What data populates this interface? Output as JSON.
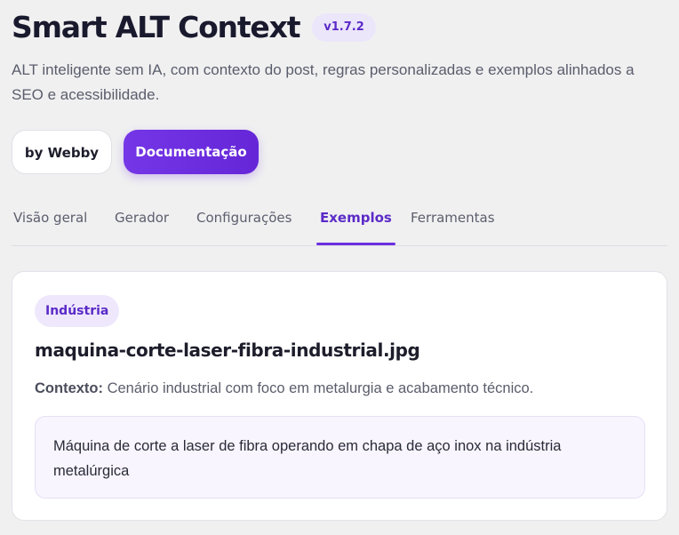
{
  "header": {
    "title": "Smart ALT Context",
    "version": "v1.7.2",
    "subtitle": "ALT inteligente sem IA, com contexto do post, regras personalizadas e exemplos alinhados a SEO e acessibilidade."
  },
  "buttons": {
    "webby_label": "by Webby",
    "docs_label": "Documentação"
  },
  "tabs": [
    {
      "label": "Visão geral",
      "active": false
    },
    {
      "label": "Gerador",
      "active": false
    },
    {
      "label": "Configurações",
      "active": false
    },
    {
      "label": "Exemplos",
      "active": true
    },
    {
      "label": "Ferramentas",
      "active": false
    }
  ],
  "example": {
    "category": "Indústria",
    "filename": "maquina-corte-laser-fibra-industrial.jpg",
    "context_label": "Contexto:",
    "context_text": "Cenário industrial com foco em metalurgia e acabamento técnico.",
    "alt_text": "Máquina de corte a laser de fibra operando em chapa de aço inox na indústria metalúrgica"
  },
  "colors": {
    "accent": "#6f2de0",
    "background": "#f0f0f1",
    "card": "#ffffff"
  }
}
